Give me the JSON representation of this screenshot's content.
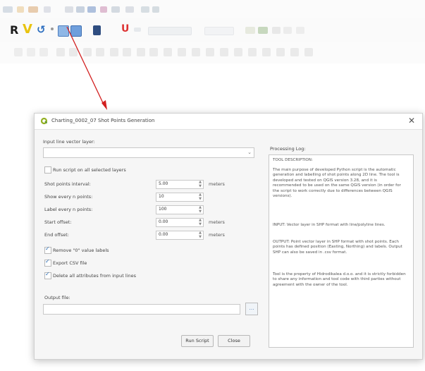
{
  "dialog": {
    "title": "Charting_0002_07 Shot Points Generation",
    "close_glyph": "✕",
    "input_layer_label": "Input line vector layer:",
    "run_all_label": "Run script on all selected layers",
    "fields": [
      {
        "label": "Shot points interval:",
        "value": "5.00",
        "unit": "meters"
      },
      {
        "label": "Show every n points:",
        "value": "10",
        "unit": ""
      },
      {
        "label": "Label every n points:",
        "value": "100",
        "unit": ""
      },
      {
        "label": "Start offset:",
        "value": "0.00",
        "unit": "meters"
      },
      {
        "label": "End offset:",
        "value": "0.00",
        "unit": "meters"
      }
    ],
    "options": [
      {
        "label": "Remove \"0\" value labels",
        "checked": true
      },
      {
        "label": "Export CSV file",
        "checked": true
      },
      {
        "label": "Delete all attributes from input lines",
        "checked": true
      }
    ],
    "output_label": "Output file:",
    "browse_glyph": "…",
    "run_button": "Run Script",
    "close_button": "Close",
    "log_title": "Processing Log:",
    "log_paragraphs": [
      "TOOL DESCRIPTION:",
      "The main purpose of developed Python script is the automatic generation and labelling of shot points along 2D line. The tool is developed and tested on QGIS version 3.28, and it is recommended to be used on the same QGIS version (in order for the script to work correctly due to differences between QGIS versions).",
      "INPUT: Vector layer in SHP format with line/polyline lines.",
      "OUTPUT: Point vector layer in SHP format with shot points. Each points has defined position (Easting, Northing) and labels. Output SHP can also be saved in .csv format.",
      "Tool is the property of Hidrodikalea d.o.o. and it is strictly forbidden to share any information and tool code with third parties without agreement with the owner of the tool."
    ]
  },
  "toolbar": {
    "icons": [
      "qgis-tool-icon",
      "v-tool-icon",
      "undo-icon",
      "plugin-icon-1",
      "plugin-icon-2",
      "book-icon",
      "magnet-icon"
    ]
  },
  "colors": {
    "arrow": "#d21f1f",
    "checkbox_tick": "#2a6db5",
    "titlebar": "#ffffff",
    "dialog_bg": "#f6f6f6"
  }
}
